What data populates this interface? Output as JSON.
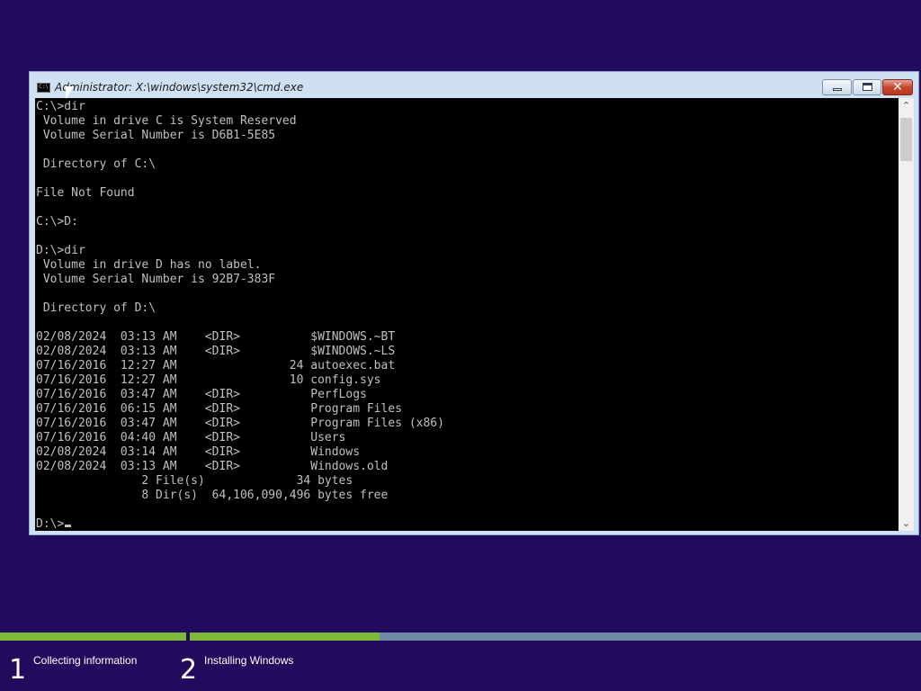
{
  "window": {
    "title": "Administrator: X:\\windows\\system32\\cmd.exe",
    "controls": {
      "minimize_glyph": "",
      "maximize_glyph": "",
      "close_glyph": "✕"
    }
  },
  "console": {
    "lines": [
      "C:\\>dir",
      " Volume in drive C is System Reserved",
      " Volume Serial Number is D6B1-5E85",
      "",
      " Directory of C:\\",
      "",
      "File Not Found",
      "",
      "C:\\>D:",
      "",
      "D:\\>dir",
      " Volume in drive D has no label.",
      " Volume Serial Number is 92B7-383F",
      "",
      " Directory of D:\\",
      "",
      "02/08/2024  03:13 AM    <DIR>          $WINDOWS.~BT",
      "02/08/2024  03:13 AM    <DIR>          $WINDOWS.~LS",
      "07/16/2016  12:27 AM                24 autoexec.bat",
      "07/16/2016  12:27 AM                10 config.sys",
      "07/16/2016  03:47 AM    <DIR>          PerfLogs",
      "07/16/2016  06:15 AM    <DIR>          Program Files",
      "07/16/2016  03:47 AM    <DIR>          Program Files (x86)",
      "07/16/2016  04:40 AM    <DIR>          Users",
      "02/08/2024  03:14 AM    <DIR>          Windows",
      "02/08/2024  03:13 AM    <DIR>          Windows.old",
      "               2 File(s)             34 bytes",
      "               8 Dir(s)  64,106,090,496 bytes free",
      ""
    ],
    "prompt": "D:\\>"
  },
  "scrollbar": {
    "up_arrow": "⌃",
    "down_arrow": "⌄"
  },
  "setup_progress": {
    "steps": [
      {
        "number": "1",
        "label": "Collecting information",
        "progress": 1.0
      },
      {
        "number": "2",
        "label": "Installing Windows",
        "progress": 0.26
      }
    ]
  },
  "colors": {
    "desktop_background": "#220a5c",
    "console_background": "#000000",
    "console_text": "#c0c0c0",
    "progress_fill": "#7fb93a",
    "progress_track": "#6f8aa3"
  }
}
